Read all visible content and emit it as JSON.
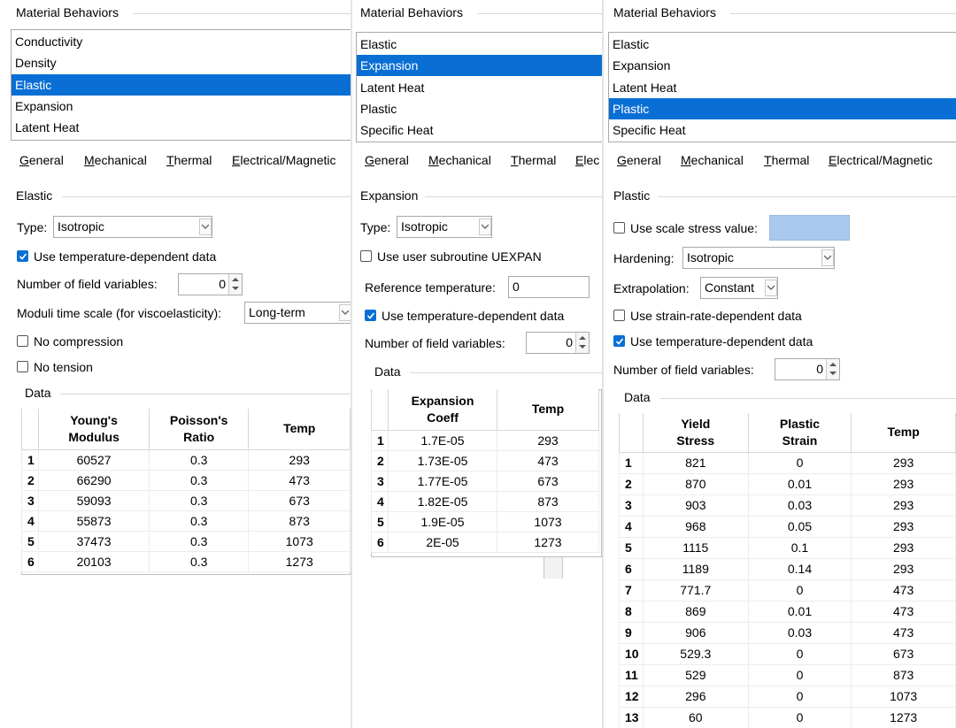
{
  "panels": [
    {
      "behaviors_title": "Material Behaviors",
      "behaviors": [
        "Conductivity",
        "Density",
        "Elastic",
        "Expansion",
        "Latent Heat"
      ],
      "selected": 2,
      "tabs": [
        "General",
        "Mechanical",
        "Thermal",
        "Electrical/Magnetic"
      ],
      "section_title": "Elastic",
      "type_label": "Type:",
      "type_value": "Isotropic",
      "use_temp_label": "Use temperature-dependent data",
      "use_temp_checked": true,
      "field_vars_label": "Number of field variables:",
      "field_vars_value": "0",
      "moduli_label": "Moduli time scale (for viscoelasticity):",
      "moduli_value": "Long-term",
      "no_compression_label": "No compression",
      "no_tension_label": "No tension",
      "data_title": "Data",
      "table": {
        "headers": [
          [
            "Young's",
            "Modulus"
          ],
          [
            "Poisson's",
            "Ratio"
          ],
          [
            "Temp",
            ""
          ]
        ],
        "rows": [
          [
            "1",
            "60527",
            "0.3",
            "293"
          ],
          [
            "2",
            "66290",
            "0.3",
            "473"
          ],
          [
            "3",
            "59093",
            "0.3",
            "673"
          ],
          [
            "4",
            "55873",
            "0.3",
            "873"
          ],
          [
            "5",
            "37473",
            "0.3",
            "1073"
          ],
          [
            "6",
            "20103",
            "0.3",
            "1273"
          ]
        ]
      }
    },
    {
      "behaviors_title": "Material Behaviors",
      "behaviors": [
        "Elastic",
        "Expansion",
        "Latent Heat",
        "Plastic",
        "Specific Heat"
      ],
      "selected": 1,
      "tabs": [
        "General",
        "Mechanical",
        "Thermal",
        "Elec"
      ],
      "section_title": "Expansion",
      "type_label": "Type:",
      "type_value": "Isotropic",
      "uexpan_label": "Use user subroutine UEXPAN",
      "ref_temp_label": "Reference temperature:",
      "ref_temp_value": "0",
      "use_temp_label": "Use temperature-dependent data",
      "use_temp_checked": true,
      "field_vars_label": "Number of field variables:",
      "field_vars_value": "0",
      "data_title": "Data",
      "table": {
        "headers": [
          [
            "Expansion",
            "Coeff"
          ],
          [
            "Temp",
            ""
          ]
        ],
        "rows": [
          [
            "1",
            "1.7E-05",
            "293"
          ],
          [
            "2",
            "1.73E-05",
            "473"
          ],
          [
            "3",
            "1.77E-05",
            "673"
          ],
          [
            "4",
            "1.82E-05",
            "873"
          ],
          [
            "5",
            "1.9E-05",
            "1073"
          ],
          [
            "6",
            "2E-05",
            "1273"
          ]
        ]
      }
    },
    {
      "behaviors_title": "Material Behaviors",
      "behaviors": [
        "Elastic",
        "Expansion",
        "Latent Heat",
        "Plastic",
        "Specific Heat"
      ],
      "selected": 3,
      "tabs": [
        "General",
        "Mechanical",
        "Thermal",
        "Electrical/Magnetic"
      ],
      "section_title": "Plastic",
      "scale_stress_label": "Use scale stress value:",
      "hardening_label": "Hardening:",
      "hardening_value": "Isotropic",
      "extrapolation_label": "Extrapolation:",
      "extrapolation_value": "Constant",
      "strain_rate_label": "Use strain-rate-dependent data",
      "use_temp_label": "Use temperature-dependent data",
      "use_temp_checked": true,
      "field_vars_label": "Number of field variables:",
      "field_vars_value": "0",
      "data_title": "Data",
      "table": {
        "headers": [
          [
            "Yield",
            "Stress"
          ],
          [
            "Plastic",
            "Strain"
          ],
          [
            "Temp",
            ""
          ]
        ],
        "rows": [
          [
            "1",
            "821",
            "0",
            "293"
          ],
          [
            "2",
            "870",
            "0.01",
            "293"
          ],
          [
            "3",
            "903",
            "0.03",
            "293"
          ],
          [
            "4",
            "968",
            "0.05",
            "293"
          ],
          [
            "5",
            "1115",
            "0.1",
            "293"
          ],
          [
            "6",
            "1189",
            "0.14",
            "293"
          ],
          [
            "7",
            "771.7",
            "0",
            "473"
          ],
          [
            "8",
            "869",
            "0.01",
            "473"
          ],
          [
            "9",
            "906",
            "0.03",
            "473"
          ],
          [
            "10",
            "529.3",
            "0",
            "673"
          ],
          [
            "11",
            "529",
            "0",
            "873"
          ],
          [
            "12",
            "296",
            "0",
            "1073"
          ],
          [
            "13",
            "60",
            "0",
            "1273"
          ]
        ]
      }
    }
  ],
  "colors": {
    "selection": "#0a6fd4",
    "scale_field": "#a9c9f0"
  }
}
